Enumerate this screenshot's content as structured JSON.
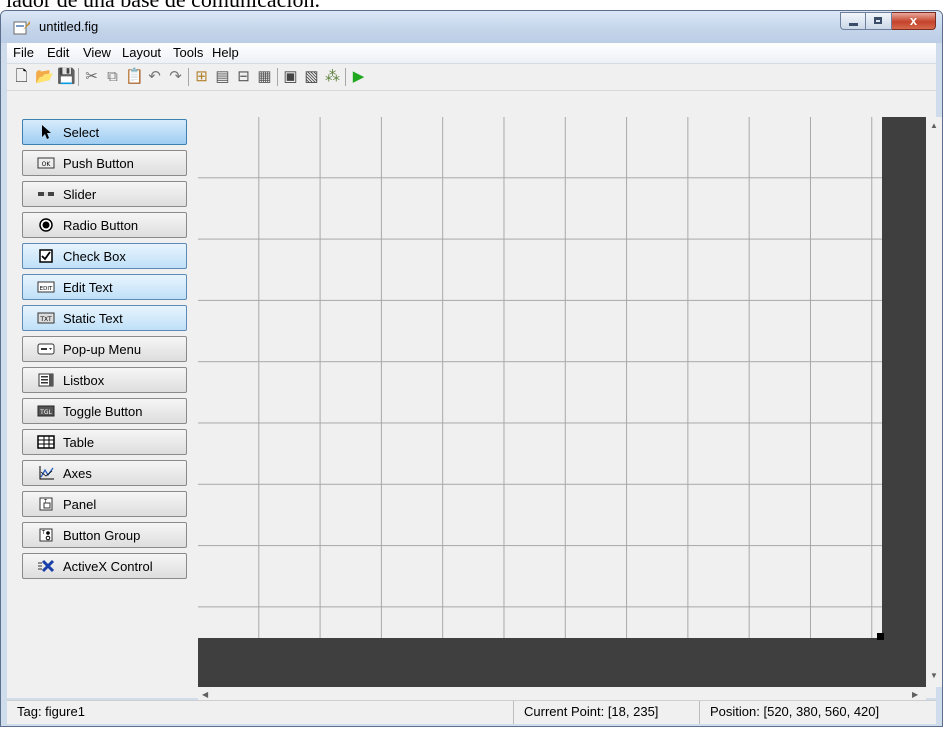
{
  "page_caption": "lador de una base de comunicación.",
  "window": {
    "title": "untitled.fig",
    "close_label": "x"
  },
  "menubar": {
    "items": [
      "File",
      "Edit",
      "View",
      "Layout",
      "Tools",
      "Help"
    ]
  },
  "toolbar": {
    "buttons": [
      {
        "icon": "new-file-icon",
        "glyph": "🗋"
      },
      {
        "icon": "open-folder-icon",
        "glyph": "📂"
      },
      {
        "icon": "save-icon",
        "glyph": "💾"
      },
      {
        "icon": "cut-icon",
        "glyph": "✂"
      },
      {
        "icon": "copy-icon",
        "glyph": "⧉"
      },
      {
        "icon": "paste-icon",
        "glyph": "📋"
      },
      {
        "icon": "undo-icon",
        "glyph": "↶"
      },
      {
        "icon": "redo-icon",
        "glyph": "↷"
      },
      {
        "icon": "align-objects-icon",
        "glyph": "⊞"
      },
      {
        "icon": "menu-editor-icon",
        "glyph": "▤"
      },
      {
        "icon": "tab-order-editor-icon",
        "glyph": "⊟"
      },
      {
        "icon": "toolbar-editor-icon",
        "glyph": "▦"
      },
      {
        "icon": "editor-icon",
        "glyph": "▣"
      },
      {
        "icon": "property-inspector-icon",
        "glyph": "▧"
      },
      {
        "icon": "object-browser-icon",
        "glyph": "⁂"
      },
      {
        "icon": "run-figure-icon",
        "glyph": "▶"
      }
    ]
  },
  "palette": {
    "items": [
      {
        "label": "Select",
        "icon": "cursor-arrow-icon"
      },
      {
        "label": "Push Button",
        "icon": "push-button-icon"
      },
      {
        "label": "Slider",
        "icon": "slider-icon"
      },
      {
        "label": "Radio Button",
        "icon": "radio-button-icon"
      },
      {
        "label": "Check Box",
        "icon": "check-box-icon"
      },
      {
        "label": "Edit Text",
        "icon": "edit-text-icon"
      },
      {
        "label": "Static Text",
        "icon": "static-text-icon"
      },
      {
        "label": "Pop-up Menu",
        "icon": "popup-menu-icon"
      },
      {
        "label": "Listbox",
        "icon": "listbox-icon"
      },
      {
        "label": "Toggle Button",
        "icon": "toggle-button-icon"
      },
      {
        "label": "Table",
        "icon": "table-icon"
      },
      {
        "label": "Axes",
        "icon": "axes-icon"
      },
      {
        "label": "Panel",
        "icon": "panel-icon"
      },
      {
        "label": "Button Group",
        "icon": "button-group-icon"
      },
      {
        "label": "ActiveX Control",
        "icon": "activex-icon"
      }
    ],
    "icon_text": {
      "push": "OK",
      "edit": "EDIT",
      "static": "TXT",
      "toggle": "TGL"
    }
  },
  "statusbar": {
    "tag": "Tag: figure1",
    "current_point": "Current Point:  [18, 235]",
    "position": "Position: [520, 380, 560, 420]"
  },
  "colors": {
    "selected": "#9fcdf2",
    "canvas_border": "#3f3f3f",
    "run": "#1fa81f"
  }
}
